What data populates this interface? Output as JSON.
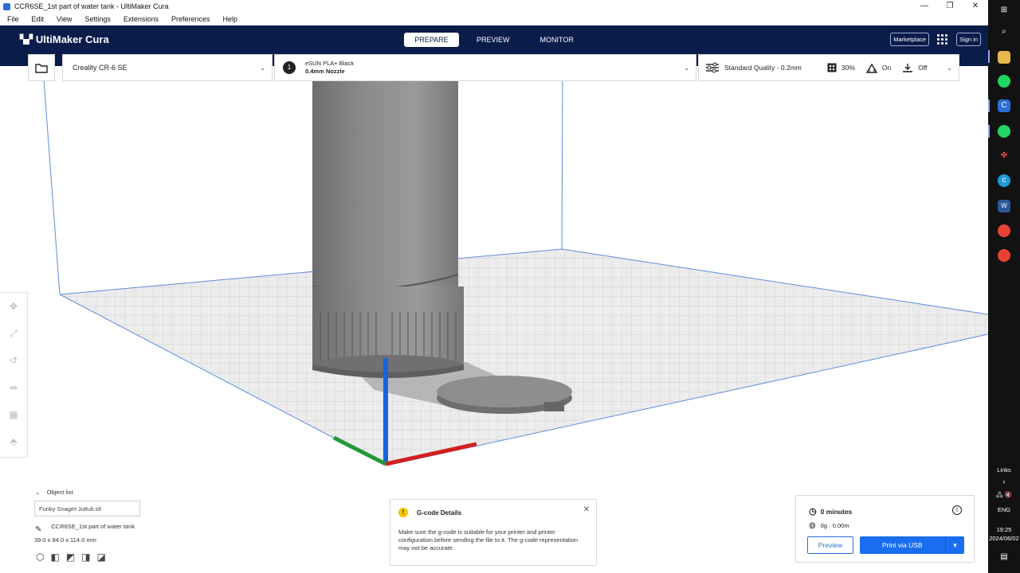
{
  "window": {
    "title": "CCR6SE_1st part of water tank - UltiMaker Cura",
    "minimize": "—",
    "restore": "❐",
    "close": "✕"
  },
  "menu": [
    "File",
    "Edit",
    "View",
    "Settings",
    "Extensions",
    "Preferences",
    "Help"
  ],
  "header": {
    "logo": "UltiMaker Cura",
    "tabs": [
      "PREPARE",
      "PREVIEW",
      "MONITOR"
    ],
    "marketplace": "Marketplace",
    "signin": "Sign in"
  },
  "printer": {
    "name": "Creality CR-6 SE"
  },
  "material": {
    "extruder": "1",
    "name": "eSUN PLA+ Black",
    "nozzle": "0.4mm Nozzle"
  },
  "quality": {
    "profile": "Standard Quality - 0.2mm",
    "infill": "30%",
    "support": "On",
    "adhesion": "Off"
  },
  "object_list": {
    "header": "Object list",
    "filename": "Funky Snaget-Juttuli.stl",
    "project": "CCR6SE_1st part of water tank",
    "dims": "39.0 x 84.0 x 114.0 mm"
  },
  "gcode_details": {
    "title": "G-code Details",
    "body": "Make sure the g-code is suitable for your printer and printer configuration before sending the file to it. The g-code representation may not be accurate."
  },
  "print_panel": {
    "time": "0 minutes",
    "material_usage": "0g · 0.00m",
    "preview_label": "Preview",
    "print_label": "Print via USB"
  },
  "taskbar": {
    "links": "Links",
    "lang": "ENG",
    "time": "19:25",
    "date": "2024/06/02"
  },
  "colors": {
    "header": "#0a1c4a",
    "accent": "#196ef0",
    "warning": "#f7c400"
  }
}
